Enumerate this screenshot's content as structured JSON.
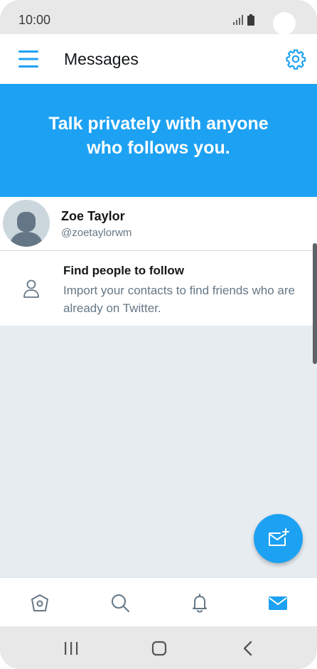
{
  "status_bar": {
    "time": "10:00"
  },
  "app_bar": {
    "title": "Messages"
  },
  "banner": {
    "text": "Talk privately with anyone who follows you."
  },
  "contact": {
    "name": "Zoe Taylor",
    "handle": "@zoetaylorwm"
  },
  "find_people": {
    "title": "Find people to follow",
    "description": "Import your contacts to find friends who are already on Twitter."
  },
  "tabs": [
    {
      "icon": "home-icon",
      "active": false
    },
    {
      "icon": "search-icon",
      "active": false
    },
    {
      "icon": "bell-icon",
      "active": false
    },
    {
      "icon": "mail-icon",
      "active": true
    }
  ],
  "colors": {
    "accent": "#1da1f2",
    "text_primary": "#14171a",
    "text_secondary": "#657786",
    "background_empty": "#e6ecf0",
    "icon_inactive": "#657786"
  }
}
